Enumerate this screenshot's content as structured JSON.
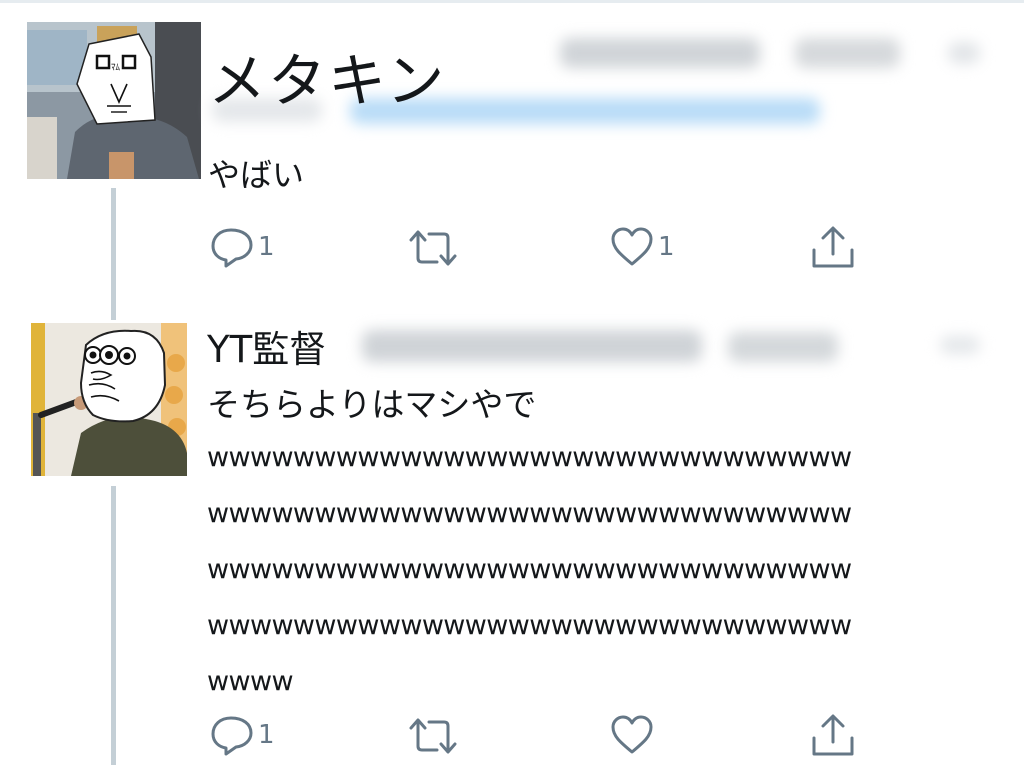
{
  "tweets": [
    {
      "display_name": "メタキン",
      "text": "やばい",
      "reply_count": "1",
      "retweet_count": "",
      "like_count": "1"
    },
    {
      "display_name": "YT監督",
      "text": "そちらよりはマシやで",
      "text_lines": [
        "wwwwwwwwwwwwwwwwwwwwwwwwwwwwww",
        "wwwwwwwwwwwwwwwwwwwwwwwwwwwwww",
        "wwwwwwwwwwwwwwwwwwwwwwwwwwwwww",
        "wwwwwwwwwwwwwwwwwwwwwwwwwwwwww",
        "wwww"
      ],
      "reply_count": "1",
      "retweet_count": "",
      "like_count": ""
    }
  ],
  "icons": {
    "reply": "reply-icon",
    "retweet": "retweet-icon",
    "like": "heart-icon",
    "share": "share-icon"
  },
  "colors": {
    "text": "#14171a",
    "action_gray": "#657786",
    "thread_line": "#c4cfd6",
    "link_blur": "#1da1f2"
  }
}
